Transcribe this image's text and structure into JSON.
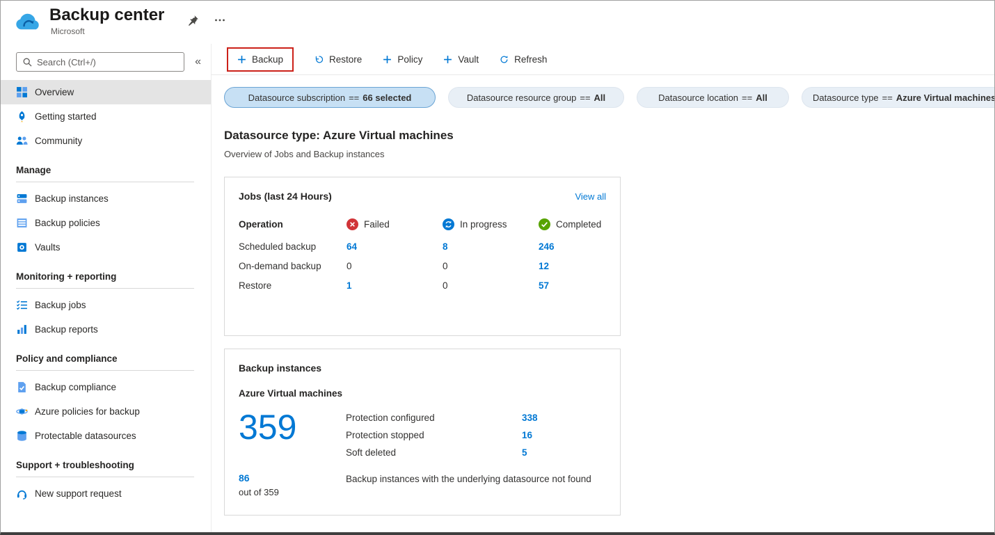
{
  "app": {
    "title": "Backup center",
    "publisher": "Microsoft"
  },
  "sidebar": {
    "search_placeholder": "Search (Ctrl+/)",
    "collapse_glyph": "«",
    "top_items": [
      {
        "label": "Overview",
        "selected": true
      },
      {
        "label": "Getting started",
        "selected": false
      },
      {
        "label": "Community",
        "selected": false
      }
    ],
    "sections": [
      {
        "title": "Manage",
        "items": [
          {
            "label": "Backup instances"
          },
          {
            "label": "Backup policies"
          },
          {
            "label": "Vaults"
          }
        ]
      },
      {
        "title": "Monitoring + reporting",
        "items": [
          {
            "label": "Backup jobs"
          },
          {
            "label": "Backup reports"
          }
        ]
      },
      {
        "title": "Policy and compliance",
        "items": [
          {
            "label": "Backup compliance"
          },
          {
            "label": "Azure policies for backup"
          },
          {
            "label": "Protectable datasources"
          }
        ]
      },
      {
        "title": "Support + troubleshooting",
        "items": [
          {
            "label": "New support request"
          }
        ]
      }
    ]
  },
  "toolbar": {
    "backup_label": "Backup",
    "restore_label": "Restore",
    "policy_label": "Policy",
    "vault_label": "Vault",
    "refresh_label": "Refresh"
  },
  "filters": [
    {
      "label": "Datasource subscription",
      "operator": "==",
      "value": "66 selected",
      "selected": true
    },
    {
      "label": "Datasource resource group",
      "operator": "==",
      "value": "All",
      "selected": false
    },
    {
      "label": "Datasource location",
      "operator": "==",
      "value": "All",
      "selected": false
    },
    {
      "label": "Datasource type",
      "operator": "==",
      "value": "Azure Virtual machines",
      "selected": false
    }
  ],
  "content": {
    "heading": "Datasource type: Azure Virtual machines",
    "subheading": "Overview of Jobs and Backup instances"
  },
  "jobs_card": {
    "title": "Jobs (last 24 Hours)",
    "view_all_label": "View all",
    "columns": {
      "operation": "Operation",
      "failed": "Failed",
      "in_progress": "In progress",
      "completed": "Completed"
    },
    "rows": [
      {
        "operation": "Scheduled backup",
        "failed": "64",
        "in_progress": "8",
        "completed": "246"
      },
      {
        "operation": "On-demand backup",
        "failed": "0",
        "in_progress": "0",
        "completed": "12"
      },
      {
        "operation": "Restore",
        "failed": "1",
        "in_progress": "0",
        "completed": "57"
      }
    ]
  },
  "instances_card": {
    "title": "Backup instances",
    "subtitle": "Azure Virtual machines",
    "total_count": "359",
    "stats": [
      {
        "label": "Protection configured",
        "value": "338"
      },
      {
        "label": "Protection stopped",
        "value": "16"
      },
      {
        "label": "Soft deleted",
        "value": "5"
      }
    ],
    "datasource_not_found": {
      "count": "86",
      "suffix": "out of 359",
      "description": "Backup instances with the underlying datasource not found"
    }
  },
  "colors": {
    "accent_blue": "#0078d4",
    "failed_red": "#d13438",
    "in_progress_blue": "#0078d4",
    "completed_green": "#57a300",
    "backup_button_highlight_red": "#cc2119",
    "selected_pill_bg": "#c7e0f4",
    "selected_nav_bg": "#e4e4e4"
  }
}
